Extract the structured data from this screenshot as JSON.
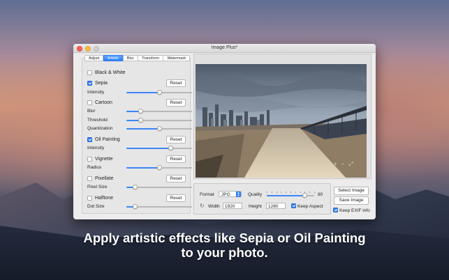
{
  "window": {
    "title": "Image Plus*"
  },
  "tabs": [
    "Adjust",
    "Artistic",
    "Blur",
    "Transform",
    "Watermark"
  ],
  "active_tab": "Artistic",
  "effects": {
    "black_white": {
      "label": "Black & White",
      "checked": false
    },
    "sepia": {
      "label": "Sepia",
      "checked": true,
      "reset": "Reset",
      "intensity": {
        "label": "Intensity",
        "value": 0.5
      }
    },
    "cartoon": {
      "label": "Cartoon",
      "checked": false,
      "reset": "Reset",
      "blur": {
        "label": "Blur",
        "value": 0.22
      },
      "threshold": {
        "label": "Threshold",
        "value": 0.22
      },
      "quantization": {
        "label": "Quantization",
        "value": 0.5
      }
    },
    "oil_painting": {
      "label": "Oil Painting",
      "checked": true,
      "reset": "Reset",
      "intensity": {
        "label": "Intensity",
        "value": 0.68
      }
    },
    "vignette": {
      "label": "Vignette",
      "checked": false,
      "reset": "Reset",
      "radius": {
        "label": "Radius",
        "value": 0.5
      }
    },
    "pixellate": {
      "label": "Pixellate",
      "checked": false,
      "reset": "Reset",
      "pixel_size": {
        "label": "Pixel Size",
        "value": 0.13
      }
    },
    "halftone": {
      "label": "Halftone",
      "checked": false,
      "reset": "Reset",
      "dot_size": {
        "label": "Dot Size",
        "value": 0.13
      }
    }
  },
  "preview": {
    "zoom_in": "+",
    "zoom_out": "−",
    "fit": "⤢"
  },
  "export": {
    "format_label": "Format",
    "format_value": "JPG",
    "quality_label": "Quality",
    "quality_value": "80",
    "quality_fraction": 0.8,
    "width_label": "Width",
    "width_value": "1920",
    "height_label": "Height",
    "height_value": "1280",
    "keep_aspect_label": "Keep Aspect",
    "keep_aspect": true,
    "keep_exif_label": "Keep EXIF info",
    "keep_exif": true,
    "select_image": "Select Image",
    "save_image": "Save Image"
  },
  "caption": {
    "line1": "Apply artistic effects like Sepia or Oil Painting",
    "line2": "to your photo."
  }
}
